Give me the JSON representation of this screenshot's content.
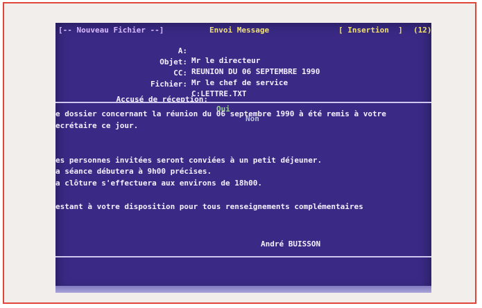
{
  "titlebar": {
    "file_label": "[-- Nouveau Fichier --]",
    "title": "Envoi Message",
    "mode": "[ Insertion  ]",
    "number": "(12)"
  },
  "header_fields": [
    {
      "label": "A:",
      "value": "Mr le directeur"
    },
    {
      "label": "Objet:",
      "value": "REUNION DU 06 SEPTEMBRE 1990"
    },
    {
      "label": "CC:",
      "value": "Mr le chef de service"
    },
    {
      "label": "Fichier:",
      "value": "C:LETTRE.TXT"
    }
  ],
  "receipt": {
    "label": "Accusé de réception:",
    "yes": "Oui",
    "no": "Non"
  },
  "body_lines": [
    "e dossier concernant la réunion du 06 septembre 1990 à été remis à votre",
    "ecrétaire ce jour.",
    "es personnes invitées seront conviées à un petit déjeuner.",
    "a séance débutera à 9h00 précises.",
    "a clôture s'effectuera aux environs de 18h00.",
    "estant à votre disposition pour tous renseignements complémentaires"
  ],
  "signature": "André BUISSON",
  "colors": {
    "screen_background": "#3a2a86",
    "text": "#f4f0ff",
    "title_text": "#f0e070",
    "frame_border": "#e0453a"
  }
}
